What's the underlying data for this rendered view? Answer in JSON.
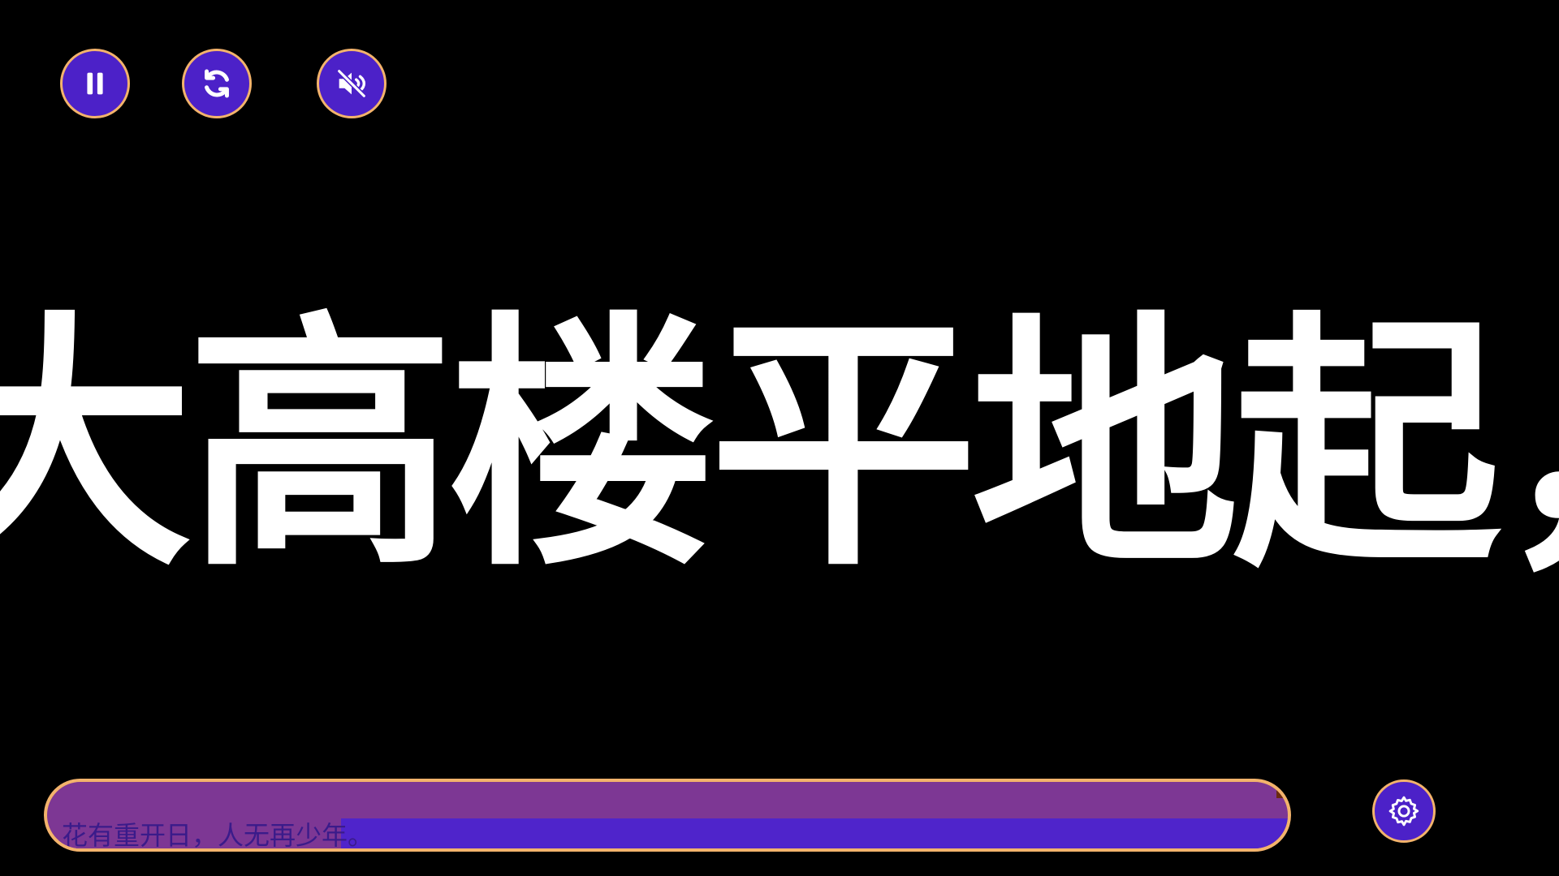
{
  "controls": {
    "pause": {
      "icon": "pause-icon"
    },
    "restart": {
      "icon": "refresh-icon"
    },
    "mute": {
      "icon": "speaker-muted-icon"
    },
    "settings": {
      "icon": "gear-icon"
    }
  },
  "marquee": {
    "text": "大高楼平地起，"
  },
  "progress": {
    "caption": "花有重开日，人无再少年。",
    "fill_fraction": 0.23
  },
  "colors": {
    "background": "#000000",
    "button_fill": "#4c21c8",
    "button_border": "#f3b36c",
    "bar_purple": "#7d3794",
    "bar_blue": "#4f24cb",
    "text": "#ffffff"
  }
}
